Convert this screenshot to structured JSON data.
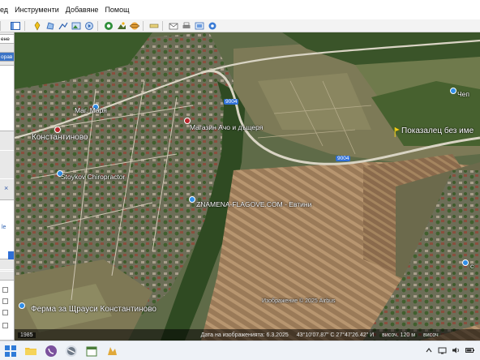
{
  "menu": {
    "items": [
      "ед",
      "Инструменти",
      "Добавяне",
      "Помощ"
    ]
  },
  "toolbar": {
    "buttons": [
      "sidebar-toggle-icon",
      "placemark-icon",
      "polygon-icon",
      "path-icon",
      "image-overlay-icon",
      "tour-icon",
      "historical-imagery-icon",
      "sun-icon",
      "planets-icon",
      "ruler-icon",
      "email-icon",
      "print-icon",
      "save-image-icon",
      "maps-icon"
    ]
  },
  "left_panel": {
    "label_1": "ене",
    "label_2": "орав",
    "close_glyph": "×",
    "label_3": "le"
  },
  "map": {
    "labels": {
      "village": "Константиново",
      "place_1": "Маг. Маря",
      "place_2": "Магазин Ачо и дъщеря",
      "place_3": "Stoykov Chiropractor",
      "place_4": "ZNAMENA-FLAGOVE.COM - Евтини",
      "place_5": "Ферма за Щрауси Константиново",
      "place_6": "Показалец без име",
      "place_7": "Чеп",
      "place_8": "с",
      "road_1": "9004",
      "road_2": "9004"
    },
    "attribution": "Изображение © 2025 Airbus"
  },
  "status": {
    "year": "1985",
    "date": "Дата на изображенията: 6.3.2025",
    "coords": "43°10'07.87\" С   27°47'26.42\" И",
    "elev": "височ.  120 м",
    "eye": "височ"
  },
  "taskbar": {
    "apps": [
      "windows-start-icon",
      "file-explorer-icon",
      "viber-icon",
      "google-earth-icon",
      "calendar-icon",
      "pinned-app-icon"
    ],
    "tray": [
      "chevron-up-icon",
      "network-icon",
      "speaker-icon",
      "battery-icon"
    ]
  }
}
